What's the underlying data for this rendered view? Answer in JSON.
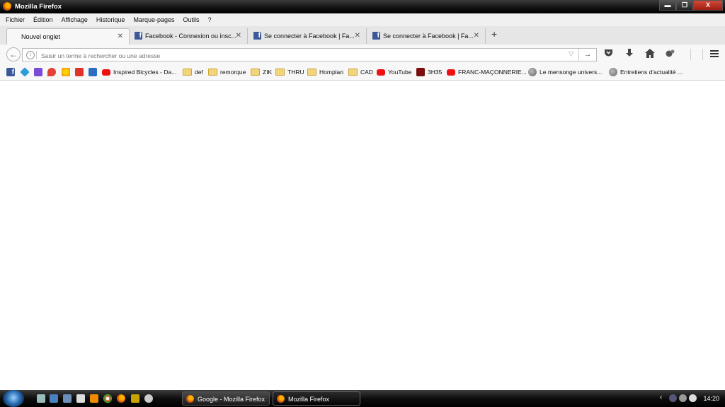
{
  "window": {
    "title": "Mozilla Firefox",
    "buttons": {
      "minimize": "▬",
      "maximize": "❐",
      "close": "X"
    }
  },
  "menu": [
    "Fichier",
    "Édition",
    "Affichage",
    "Historique",
    "Marque-pages",
    "Outils",
    "?"
  ],
  "tabs": [
    {
      "label": "Nouvel onglet",
      "active": true
    },
    {
      "label": "Facebook - Connexion ou insc...",
      "active": false
    },
    {
      "label": "Se connecter à Facebook | Fa...",
      "active": false
    },
    {
      "label": "Se connecter à Facebook | Fa...",
      "active": false
    }
  ],
  "tab_close_glyph": "✕",
  "new_tab_glyph": "+",
  "urlbar": {
    "placeholder": "Saisir un terme à rechercher ou une adresse",
    "value": ""
  },
  "bookmarks": [
    {
      "label": "",
      "icon": "facebook-icon"
    },
    {
      "label": "",
      "icon": "diamond-icon"
    },
    {
      "label": "",
      "icon": "triangle-icon"
    },
    {
      "label": "",
      "icon": "red-pin-icon"
    },
    {
      "label": "",
      "icon": "sun-icon"
    },
    {
      "label": "",
      "icon": "tv-icon"
    },
    {
      "label": "",
      "icon": "c-icon"
    },
    {
      "label": "Inspired Bicycles - Da...",
      "icon": "youtube-icon"
    },
    {
      "label": "def",
      "icon": "folder-icon"
    },
    {
      "label": "remorque",
      "icon": "folder-icon"
    },
    {
      "label": "ZIK",
      "icon": "folder-icon"
    },
    {
      "label": "THRU",
      "icon": "folder-icon"
    },
    {
      "label": "Homplan",
      "icon": "folder-icon"
    },
    {
      "label": "CAD",
      "icon": "folder-icon"
    },
    {
      "label": "YouTube",
      "icon": "youtube-icon"
    },
    {
      "label": "3H35",
      "icon": "3h35-icon"
    },
    {
      "label": "FRANC-MAÇONNERIE...",
      "icon": "youtube-icon"
    },
    {
      "label": "Le mensonge univers...",
      "icon": "globe-icon"
    },
    {
      "label": "Entretiens d'actualité ...",
      "icon": "globe-icon"
    }
  ],
  "taskbar": {
    "tasks": [
      {
        "label": "Google - Mozilla Firefox",
        "active": false
      },
      {
        "label": "Mozilla Firefox",
        "active": true
      }
    ],
    "clock": "14:20"
  },
  "colors": {
    "facebook": "#3b5998",
    "youtube": "#ee1111",
    "folder": "#f2d57a",
    "taskbar": "#0d0d0d"
  }
}
